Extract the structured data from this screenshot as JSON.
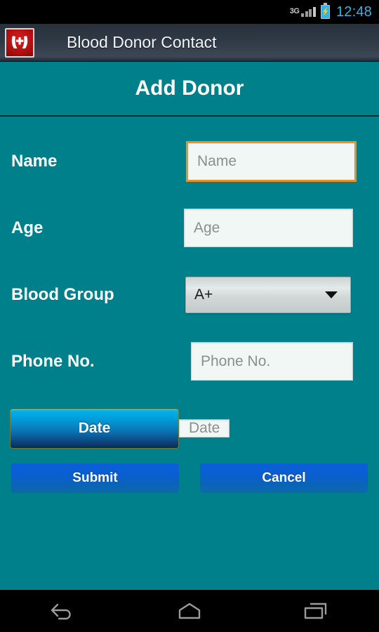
{
  "status_bar": {
    "network_type": "3G",
    "signal_icon": "signal-bars-icon",
    "battery_icon": "battery-charging-icon",
    "clock": "12:48"
  },
  "action_bar": {
    "app_icon": "blood-donor-app-icon",
    "title": "Blood Donor Contact"
  },
  "screen": {
    "title": "Add Donor"
  },
  "form": {
    "fields": [
      {
        "name": "name",
        "label": "Name",
        "placeholder": "Name",
        "value": "",
        "focused": true,
        "focus_color": "#f09020"
      },
      {
        "name": "age",
        "label": "Age",
        "placeholder": "Age",
        "value": "",
        "focused": false
      },
      {
        "name": "blood_group",
        "label": "Blood Group",
        "selected": "A+",
        "caret_icon": "chevron-down-icon"
      },
      {
        "name": "phone",
        "label": "Phone No.",
        "placeholder": "Phone No.",
        "value": "",
        "focused": false
      },
      {
        "name": "date",
        "button_label": "Date",
        "placeholder": "Date",
        "value": "",
        "focused": false
      }
    ]
  },
  "actions": {
    "submit_label": "Submit",
    "cancel_label": "Cancel"
  },
  "nav_bar": {
    "back_icon": "back-arrow-icon",
    "home_icon": "home-icon",
    "recents_icon": "recent-apps-icon"
  },
  "colors": {
    "background_teal": "#00808a",
    "action_bar_dark": "#2f3945",
    "focus_orange": "#f09020",
    "button_blue": "#0a5ed6",
    "accent_cyan": "#00b4ef",
    "status_clock_blue": "#33b5e5"
  }
}
